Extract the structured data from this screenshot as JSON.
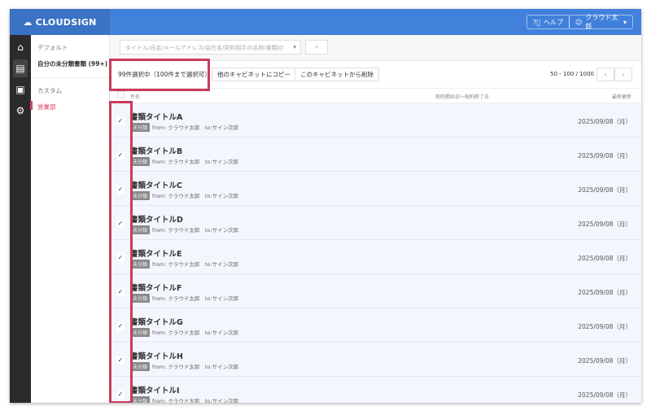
{
  "header": {
    "logo": "CLOUDSIGN",
    "help": "ヘルプ",
    "user": "クラウド太郎"
  },
  "sidebar": {
    "default_label": "デフォルト",
    "unclassified": "自分の未分類書類 (99+)",
    "custom_label": "カスタム",
    "sales": "営業部"
  },
  "search": {
    "placeholder": "タイトル/氏名/メールアドレス/会社名/契約相手の名称/書類ID"
  },
  "actions": {
    "selected": "99件選択中（100件まで選択可）",
    "copy": "他のキャビネットにコピー",
    "remove": "このキャビネットから削除",
    "pagination": "50 - 100 / 1000"
  },
  "columns": {
    "name": "件名",
    "period": "契約開始日〜契約終了日",
    "updated": "最終更新"
  },
  "rows": [
    {
      "title": "書類タイトルA",
      "badge": "未分類",
      "meta": "from: クラウド太郎　to:サイン次郎",
      "date": "2025/09/08（月）"
    },
    {
      "title": "書類タイトルB",
      "badge": "未分類",
      "meta": "from: クラウド太郎　to:サイン次郎",
      "date": "2025/09/08（月）"
    },
    {
      "title": "書類タイトルC",
      "badge": "未分類",
      "meta": "from: クラウド太郎　to:サイン次郎",
      "date": "2025/09/08（月）"
    },
    {
      "title": "書類タイトルD",
      "badge": "未分類",
      "meta": "from: クラウド太郎　to:サイン次郎",
      "date": "2025/09/08（月）"
    },
    {
      "title": "書類タイトルE",
      "badge": "未分類",
      "meta": "from: クラウド太郎　to:サイン次郎",
      "date": "2025/09/08（月）"
    },
    {
      "title": "書類タイトルF",
      "badge": "未分類",
      "meta": "from: クラウド太郎　to:サイン次郎",
      "date": "2025/09/08（月）"
    },
    {
      "title": "書類タイトルG",
      "badge": "未分類",
      "meta": "from: クラウド太郎　to:サイン次郎",
      "date": "2025/09/08（月）"
    },
    {
      "title": "書類タイトルH",
      "badge": "未分類",
      "meta": "from: クラウド太郎　to:サイン次郎",
      "date": "2025/09/08（月）"
    },
    {
      "title": "書類タイトルI",
      "badge": "未分類",
      "meta": "from: クラウド太郎　to:サイン次郎",
      "date": "2025/09/08（月）"
    }
  ]
}
